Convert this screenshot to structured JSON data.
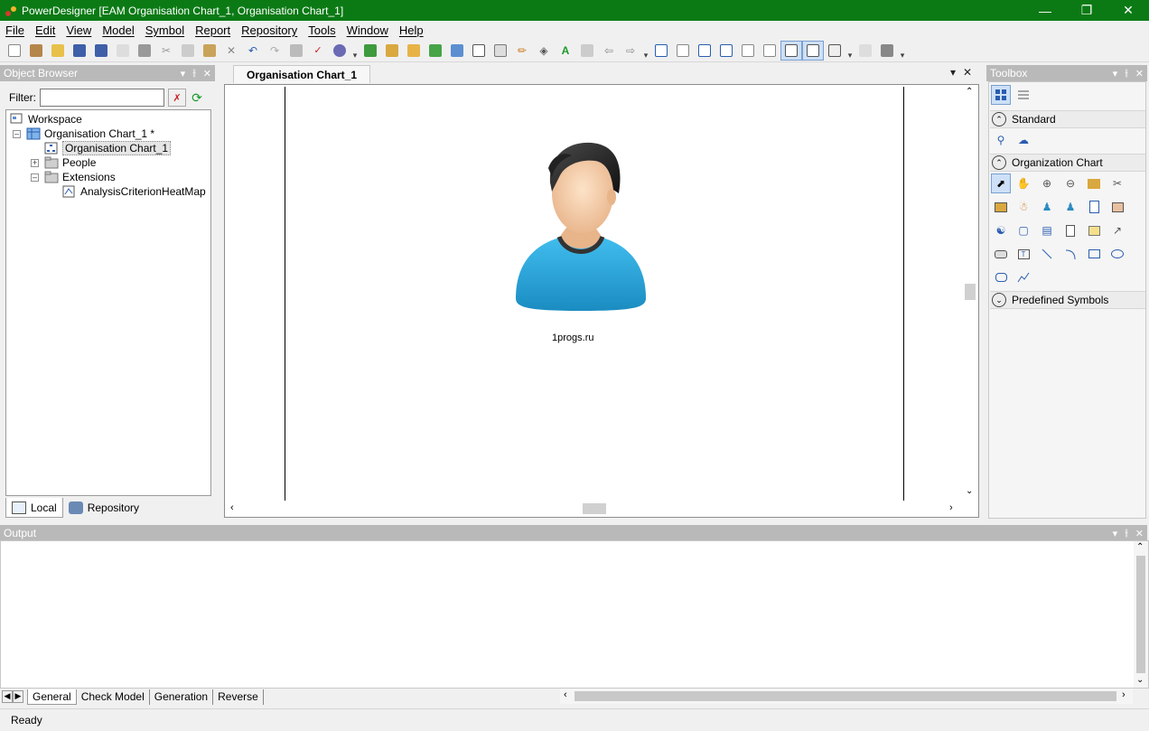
{
  "window": {
    "title": "PowerDesigner [EAM Organisation Chart_1, Organisation Chart_1]"
  },
  "menu": [
    "File",
    "Edit",
    "View",
    "Model",
    "Symbol",
    "Report",
    "Repository",
    "Tools",
    "Window",
    "Help"
  ],
  "object_browser": {
    "title": "Object Browser",
    "filter_label": "Filter:",
    "filter_value": "",
    "tree": [
      {
        "label": "Workspace"
      },
      {
        "label": "Organisation Chart_1 *"
      },
      {
        "label": "Organisation Chart_1"
      },
      {
        "label": "People"
      },
      {
        "label": "Extensions"
      },
      {
        "label": "AnalysisCriterionHeatMap"
      }
    ],
    "tabs": [
      "Local",
      "Repository"
    ]
  },
  "document": {
    "tab_label": "Organisation Chart_1",
    "avatar_caption": "1progs.ru"
  },
  "toolbox": {
    "title": "Toolbox",
    "sections": [
      "Standard",
      "Organization Chart",
      "Predefined Symbols"
    ]
  },
  "output": {
    "title": "Output",
    "tabs": [
      "General",
      "Check Model",
      "Generation",
      "Reverse"
    ]
  },
  "status": {
    "text": "Ready"
  },
  "colors": {
    "titlebar": "#0b7a15",
    "panel_title": "#b9b9b9",
    "person_shirt": "#2aa7d9"
  }
}
